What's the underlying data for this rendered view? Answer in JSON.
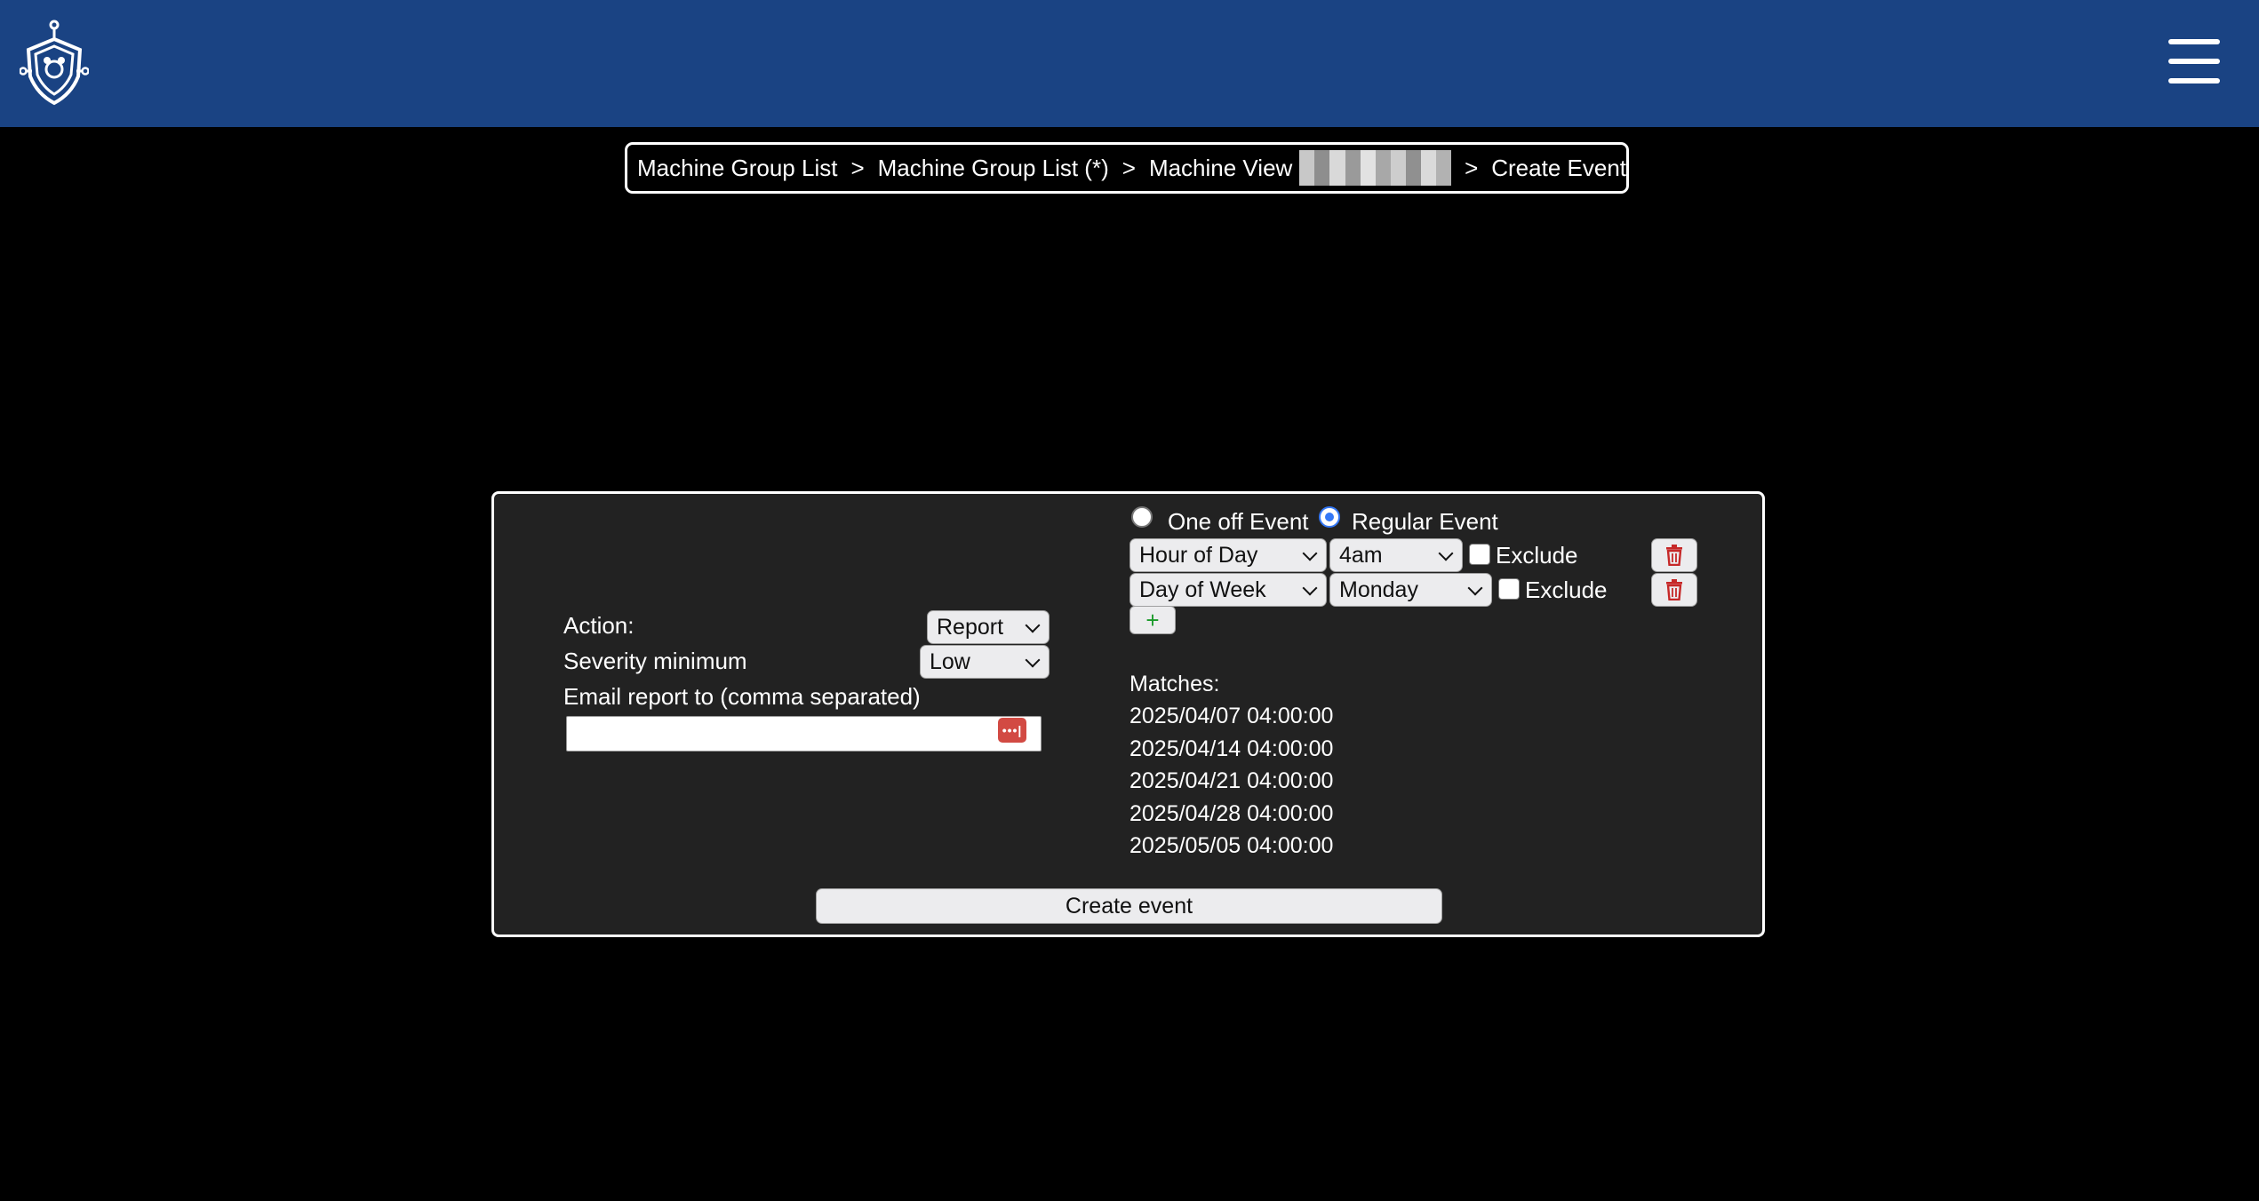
{
  "header": {
    "logo_icon": "shield-circuit-logo",
    "menu_icon": "hamburger-menu-icon",
    "background_color": "#1a4383"
  },
  "breadcrumb": {
    "items": [
      "Machine Group List",
      "Machine Group List (*)",
      "Machine View",
      "Create Event"
    ],
    "separator": ">"
  },
  "form": {
    "action_label": "Action:",
    "action_value": "Report",
    "severity_label": "Severity minimum",
    "severity_value": "Low",
    "email_label": "Email report to (comma separated)",
    "email_value": "",
    "event_types": {
      "one_off": "One off Event",
      "regular": "Regular Event",
      "selected": "Regular Event"
    },
    "rules": [
      {
        "type": "Hour of Day",
        "value": "4am",
        "exclude_label": "Exclude",
        "exclude_checked": false
      },
      {
        "type": "Day of Week",
        "value": "Monday",
        "exclude_label": "Exclude",
        "exclude_checked": false
      }
    ],
    "add_rule_label": "+",
    "matches_label": "Matches:",
    "matches": [
      "2025/04/07 04:00:00",
      "2025/04/14 04:00:00",
      "2025/04/21 04:00:00",
      "2025/04/28 04:00:00",
      "2025/05/05 04:00:00"
    ],
    "create_button": "Create event"
  },
  "annotation": {
    "arrow_color": "#e8412c"
  }
}
